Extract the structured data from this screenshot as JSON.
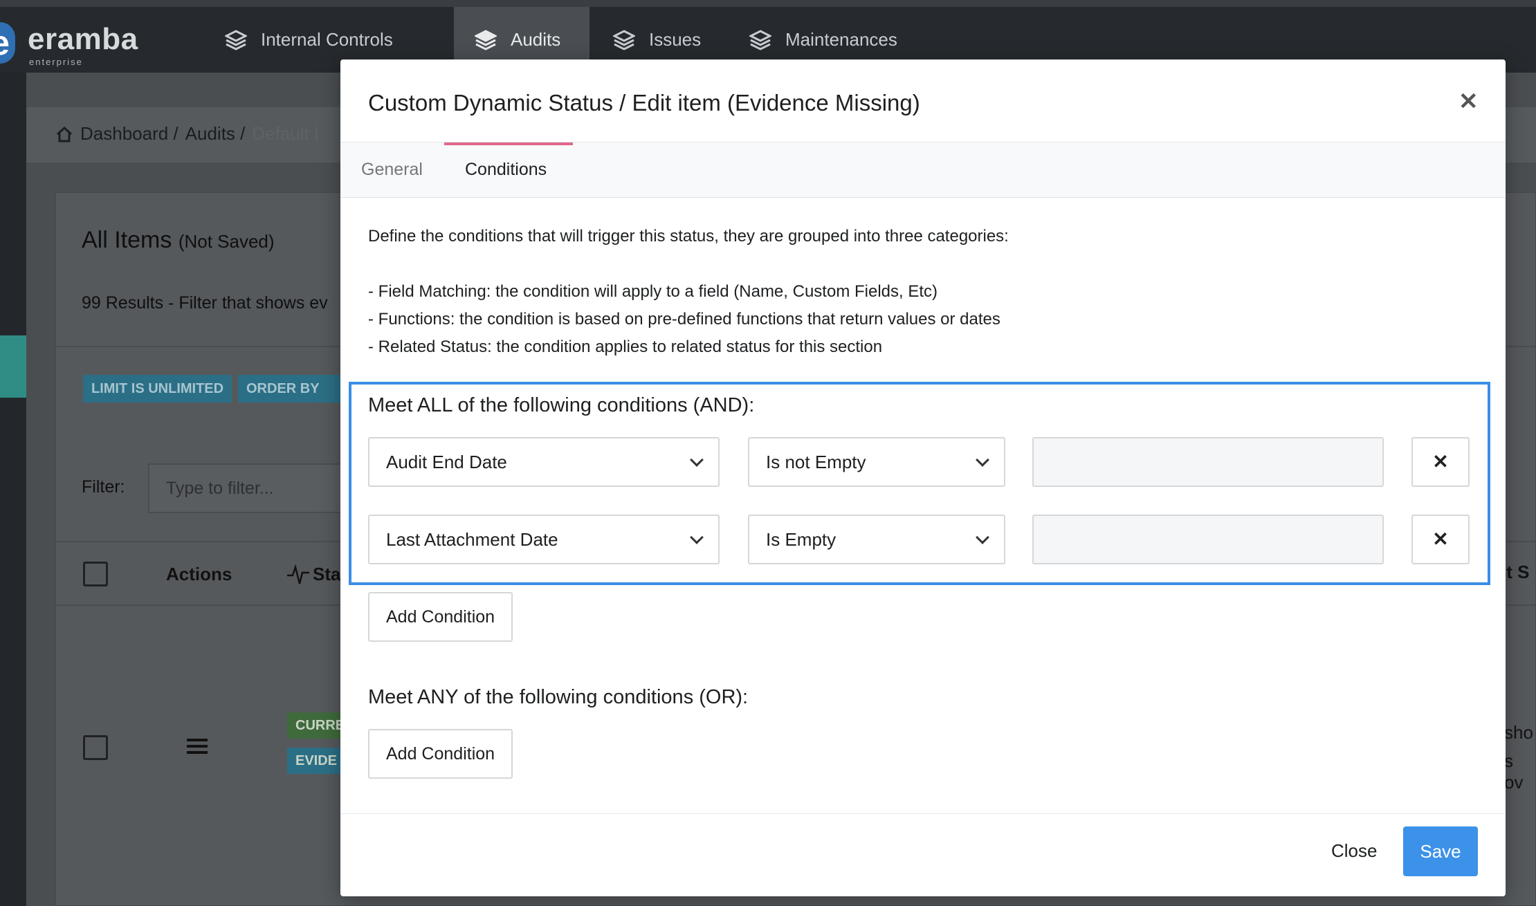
{
  "app": {
    "logo_text": "eramba",
    "logo_sub": "enterprise",
    "nav_tabs": [
      {
        "label": "Internal Controls",
        "icon": "layers-icon"
      },
      {
        "label": "Audits",
        "icon": "layers-icon",
        "active": true
      },
      {
        "label": "Issues",
        "icon": "layers-icon"
      },
      {
        "label": "Maintenances",
        "icon": "layers-icon"
      }
    ]
  },
  "background": {
    "breadcrumb": [
      "Dashboard /",
      "Audits /",
      "Default I"
    ],
    "card_title": "All Items",
    "card_title_note": "(Not Saved)",
    "results_text": "99 Results - Filter that shows ev",
    "tags": [
      "LIMIT IS UNLIMITED",
      "ORDER BY CF"
    ],
    "filter_label": "Filter:",
    "filter_placeholder": "Type to filter...",
    "columns": [
      "Actions",
      "Sta"
    ],
    "row_badges": [
      "CURRE",
      "EVIDE"
    ],
    "right_fragments": [
      "it S",
      "sho",
      "s ov"
    ]
  },
  "modal": {
    "title": "Custom Dynamic Status / Edit item (Evidence Missing)",
    "tabs": [
      "General",
      "Conditions"
    ],
    "active_tab": "Conditions",
    "intro": "Define the conditions that will trigger this status, they are grouped into three categories:",
    "bullets": [
      "- Field Matching: the condition will apply to a field (Name, Custom Fields, Etc)",
      "- Functions: the condition is based on pre-defined functions that return values or dates",
      "- Related Status: the condition applies to related status for this section"
    ],
    "and_title": "Meet ALL of the following conditions (AND):",
    "and_conditions": [
      {
        "field": "Audit End Date",
        "operator": "Is not Empty",
        "value": ""
      },
      {
        "field": "Last Attachment Date",
        "operator": "Is Empty",
        "value": ""
      }
    ],
    "add_condition_label": "Add Condition",
    "or_title": "Meet ANY of the following conditions (OR):",
    "close_label": "Close",
    "save_label": "Save"
  },
  "colors": {
    "accent_save": "#3c92e8",
    "tab_underline": "#e0688b",
    "highlight_border": "#3a8ee6"
  }
}
